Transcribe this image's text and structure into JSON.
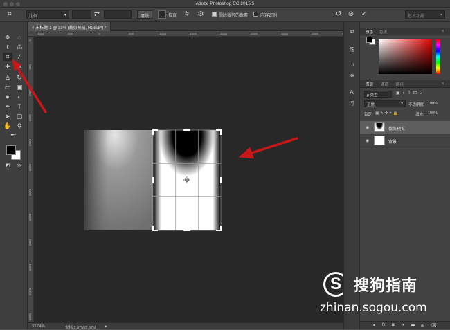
{
  "app": {
    "title": "Adobe Photoshop CC 2015.5"
  },
  "options_bar": {
    "ratio_select": "比例",
    "swap_icon": "swap-arrows-icon",
    "clear_label": "清除",
    "straighten_label": "拉直",
    "delete_cropped_label": "删除裁剪的像素",
    "content_aware_label": "内容识别",
    "workspace_select": "基本功能"
  },
  "tools": [
    "move",
    "marquee",
    "lasso",
    "magic-wand",
    "crop",
    "eyedropper",
    "healing",
    "brush",
    "stamp",
    "history-brush",
    "eraser",
    "gradient",
    "blur",
    "dodge",
    "pen",
    "type",
    "path-select",
    "shape",
    "hand",
    "zoom"
  ],
  "document": {
    "tab_label": "未标题-1 @ 33% (裁剪预览, RGB/8*) *",
    "ruler_h_marks": [
      "1000",
      "500",
      "0",
      "500",
      "1000",
      "1500",
      "2000",
      "2500",
      "3000",
      "3500",
      "4000"
    ],
    "ruler_v_marks": [
      "0",
      "500",
      "1000",
      "1500",
      "2000",
      "2500",
      "3000",
      "3500",
      "4000",
      "4500",
      "5000",
      "5500"
    ]
  },
  "status": {
    "zoom": "33.04%",
    "doc_info": "文档:2.87M/2.87M"
  },
  "panels": {
    "color_tabs": [
      "颜色",
      "色板"
    ],
    "layers_tabs": [
      "图层",
      "通道",
      "路径"
    ],
    "kind_label": "ρ 类型",
    "blend_mode": "正常",
    "opacity_label": "不透明度:",
    "opacity_value": "100%",
    "lock_label": "锁定:",
    "fill_label": "填充:",
    "fill_value": "100%",
    "layers": [
      {
        "name": "裁剪预览",
        "selected": true
      },
      {
        "name": "背景",
        "selected": false
      }
    ],
    "bottom_icons": [
      "link-icon",
      "fx-icon",
      "mask-icon",
      "adjustment-icon",
      "folder-icon",
      "new-layer-icon",
      "trash-icon"
    ]
  },
  "watermark": {
    "brand": "搜狗指南",
    "url": "zhinan.sogou.com"
  },
  "colors": {
    "annotation_arrow": "#c8171b",
    "watermark": "#ffffff",
    "foreground": "#000000",
    "background": "#ffffff"
  }
}
